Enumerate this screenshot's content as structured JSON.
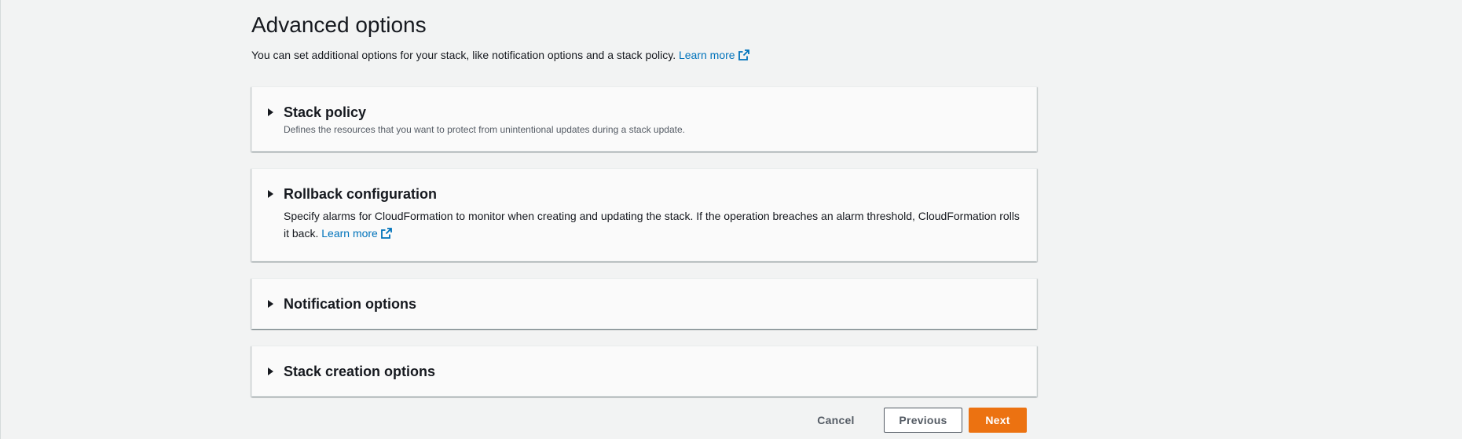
{
  "page": {
    "title": "Advanced options",
    "description": "You can set additional options for your stack, like notification options and a stack policy.",
    "learn_more": "Learn more"
  },
  "panels": [
    {
      "title": "Stack policy",
      "description": "Defines the resources that you want to protect from unintentional updates during a stack update."
    },
    {
      "title": "Rollback configuration",
      "description": "Specify alarms for CloudFormation to monitor when creating and updating the stack. If the operation breaches an alarm threshold, CloudFormation rolls it back.",
      "learn_more": "Learn more"
    },
    {
      "title": "Notification options"
    },
    {
      "title": "Stack creation options"
    }
  ],
  "actions": {
    "cancel": "Cancel",
    "previous": "Previous",
    "next": "Next"
  },
  "icons": {
    "panel_toggle": "caret-right-icon",
    "external_link": "external-link-icon"
  },
  "colors": {
    "background": "#f2f3f3",
    "panel": "#fafafa",
    "link": "#0073bb",
    "primary_button": "#ec7211",
    "secondary_text": "#545b64"
  }
}
